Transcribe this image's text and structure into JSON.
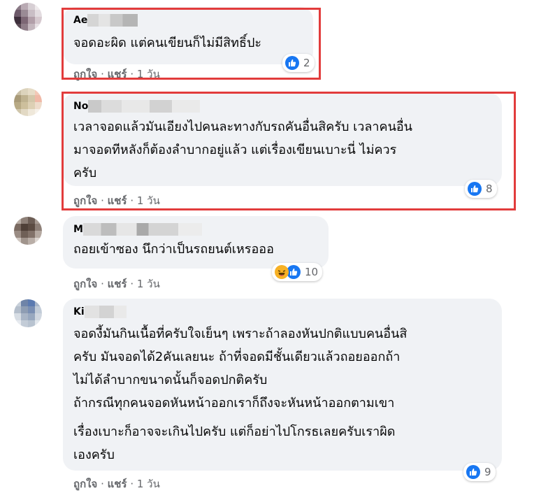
{
  "comments": [
    {
      "author": "Ae",
      "lines": [
        "จอดอะผิด แต่คนเขียนก็ไม่มีสิทธิ์ปะ"
      ],
      "like_label": "ถูกใจ",
      "reply_label": "แชร์",
      "separator": "·",
      "time": "1 วัน",
      "reaction_count": "2",
      "reactions": [
        "like-icon"
      ],
      "highlighted": true
    },
    {
      "author": "No",
      "lines": [
        "เวลาจอดแล้วมันเอียงไปคนละทางกับรถคันอื่นสิครับ เวลาคนอื่น",
        "มาจอดทีหลังก็ต้องลำบากอยู่แล้ว แต่เรื่องเขียนเบาะนี่ ไม่ควร",
        "ครับ"
      ],
      "like_label": "ถูกใจ",
      "reply_label": "แชร์",
      "separator": "·",
      "time": "1 วัน",
      "reaction_count": "8",
      "reactions": [
        "like-icon"
      ],
      "highlighted": true
    },
    {
      "author": "M",
      "lines": [
        "ถอยเข้าซอง นึกว่าเป็นรถยนต์เหรอออ"
      ],
      "like_label": "ถูกใจ",
      "reply_label": "แชร์",
      "separator": "·",
      "time": "1 วัน",
      "reaction_count": "10",
      "reactions": [
        "haha-icon",
        "like-icon"
      ],
      "highlighted": false
    },
    {
      "author": "Ki",
      "lines": [
        "จอดงี้มันกินเนื้อที่ครับใจเย็นๆ เพราะถ้าลองหันปกติแบบคนอื่นสิ",
        "ครับ มันจอดได้2คันเลยนะ ถ้าที่จอดมีชั้นเดียวแล้วถอยออกถ้า",
        "ไม่ได้ลำบากขนาดนั้นก็จอดปกติครับ",
        "ถ้ากรณีทุกคนจอดหันหน้าออกเราก็ถึงจะหันหน้าออกตามเขา",
        "เรื่องเบาะก็อาจจะเกินไปครับ แต่ก็อย่าไปโกรธเลยครับเราผิด",
        "เองครับ"
      ],
      "like_label": "ถูกใจ",
      "reply_label": "แชร์",
      "separator": "·",
      "time": "1 วัน",
      "reaction_count": "9",
      "reactions": [
        "like-icon"
      ],
      "highlighted": false
    }
  ],
  "colors": {
    "bubble": "#f0f2f5",
    "highlight": "#e23c3c",
    "like": "#1877f2",
    "meta_text": "#65676b"
  }
}
